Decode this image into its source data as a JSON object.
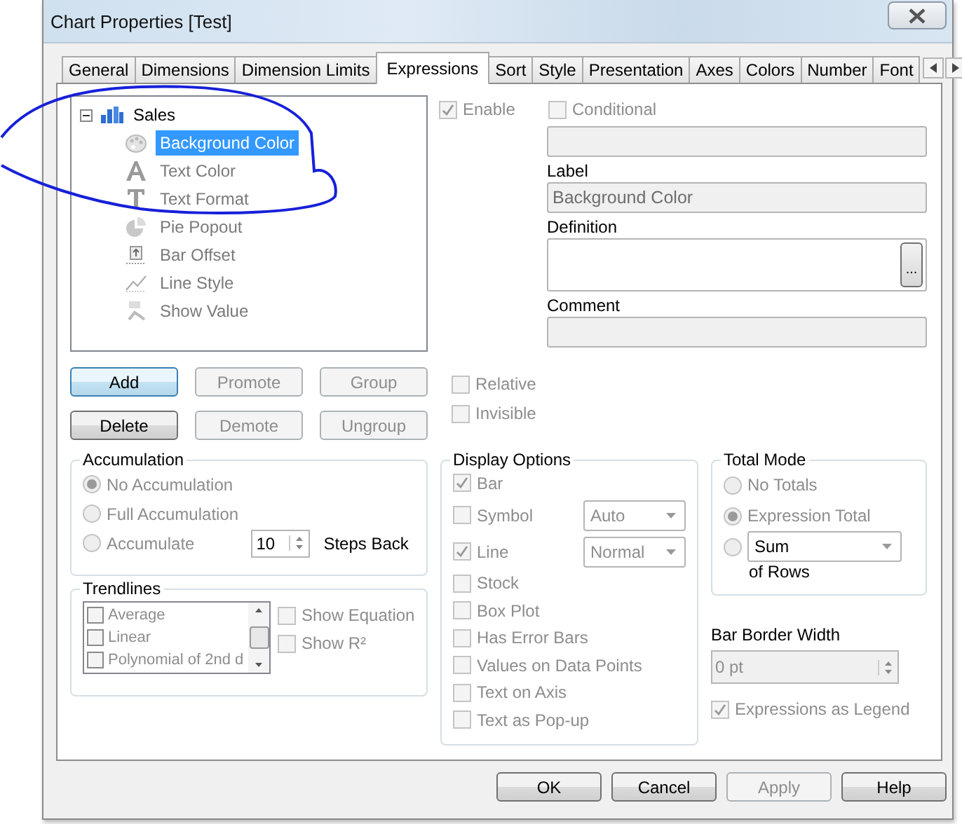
{
  "window": {
    "title": "Chart Properties [Test]"
  },
  "tabs": [
    {
      "label": "General",
      "selected": false
    },
    {
      "label": "Dimensions",
      "selected": false
    },
    {
      "label": "Dimension Limits",
      "selected": false
    },
    {
      "label": "Expressions",
      "selected": true
    },
    {
      "label": "Sort",
      "selected": false
    },
    {
      "label": "Style",
      "selected": false
    },
    {
      "label": "Presentation",
      "selected": false
    },
    {
      "label": "Axes",
      "selected": false
    },
    {
      "label": "Colors",
      "selected": false
    },
    {
      "label": "Number",
      "selected": false
    },
    {
      "label": "Font",
      "selected": false
    }
  ],
  "expressions_tree": {
    "label": "Sales",
    "expanded": true,
    "children": [
      {
        "label": "Background Color",
        "kind": "palette",
        "selected": true
      },
      {
        "label": "Text Color",
        "kind": "letter-a",
        "selected": false
      },
      {
        "label": "Text Format",
        "kind": "letter-t",
        "selected": false
      },
      {
        "label": "Pie Popout",
        "kind": "pie",
        "selected": false
      },
      {
        "label": "Bar Offset",
        "kind": "offset",
        "selected": false
      },
      {
        "label": "Line Style",
        "kind": "line",
        "selected": false
      },
      {
        "label": "Show Value",
        "kind": "value",
        "selected": false
      }
    ]
  },
  "tree_buttons": [
    [
      {
        "label": "Add",
        "disabled": false,
        "focused": true
      },
      {
        "label": "Promote",
        "disabled": true,
        "focused": false
      },
      {
        "label": "Group",
        "disabled": true,
        "focused": false
      }
    ],
    [
      {
        "label": "Delete",
        "disabled": false,
        "focused": false
      },
      {
        "label": "Demote",
        "disabled": true,
        "focused": false
      },
      {
        "label": "Ungroup",
        "disabled": true,
        "focused": false
      }
    ]
  ],
  "expression": {
    "enable": {
      "label": "Enable",
      "checked": true,
      "disabled": true
    },
    "conditional": {
      "label": "Conditional",
      "checked": false,
      "disabled": true
    },
    "label_caption": "Label",
    "label_value": "Background Color",
    "definition_caption": "Definition",
    "definition_button": "...",
    "comment_caption": "Comment"
  },
  "flags": [
    {
      "label": "Relative",
      "checked": false,
      "disabled": true
    },
    {
      "label": "Invisible",
      "checked": false,
      "disabled": true
    }
  ],
  "accumulation": {
    "title": "Accumulation",
    "options": [
      {
        "label": "No Accumulation",
        "selected": true,
        "disabled": true
      },
      {
        "label": "Full Accumulation",
        "selected": false,
        "disabled": true
      },
      {
        "label": "Accumulate",
        "selected": false,
        "disabled": true
      }
    ],
    "steps_value": "10",
    "steps_label": "Steps Back"
  },
  "trendlines": {
    "title": "Trendlines",
    "items": [
      {
        "label": "Average",
        "checked": false
      },
      {
        "label": "Linear",
        "checked": false
      },
      {
        "label": "Polynomial of 2nd d",
        "checked": false
      }
    ],
    "options": [
      {
        "label": "Show Equation",
        "checked": false,
        "disabled": true
      },
      {
        "label": "Show R²",
        "checked": false,
        "disabled": true
      }
    ]
  },
  "display_options": {
    "title": "Display Options",
    "items": [
      {
        "label": "Bar",
        "checked": true,
        "disabled": true,
        "kind": "check"
      },
      {
        "label": "Symbol",
        "checked": false,
        "disabled": true,
        "kind": "select",
        "value": "Auto"
      },
      {
        "label": "Line",
        "checked": true,
        "disabled": true,
        "kind": "select",
        "value": "Normal"
      },
      {
        "label": "Stock",
        "checked": false,
        "disabled": true,
        "kind": "check"
      },
      {
        "label": "Box Plot",
        "checked": false,
        "disabled": true,
        "kind": "check"
      },
      {
        "label": "Has Error Bars",
        "checked": false,
        "disabled": true,
        "kind": "check"
      },
      {
        "label": "Values on Data Points",
        "checked": false,
        "disabled": true,
        "kind": "check"
      },
      {
        "label": "Text on Axis",
        "checked": false,
        "disabled": true,
        "kind": "check"
      },
      {
        "label": "Text as Pop-up",
        "checked": false,
        "disabled": true,
        "kind": "check"
      }
    ]
  },
  "total_mode": {
    "title": "Total Mode",
    "options": [
      {
        "label": "No Totals",
        "selected": false,
        "disabled": true
      },
      {
        "label": "Expression Total",
        "selected": true,
        "disabled": true
      }
    ],
    "sum_selected": false,
    "sum_value": "Sum",
    "rows_label": "of Rows"
  },
  "bar_border_width": {
    "label": "Bar Border Width",
    "value": "0 pt"
  },
  "legend_option": {
    "label": "Expressions as Legend",
    "checked": true,
    "disabled": true
  },
  "buttons": [
    {
      "label": "OK",
      "disabled": false
    },
    {
      "label": "Cancel",
      "disabled": false
    },
    {
      "label": "Apply",
      "disabled": true
    },
    {
      "label": "Help",
      "disabled": false
    }
  ]
}
